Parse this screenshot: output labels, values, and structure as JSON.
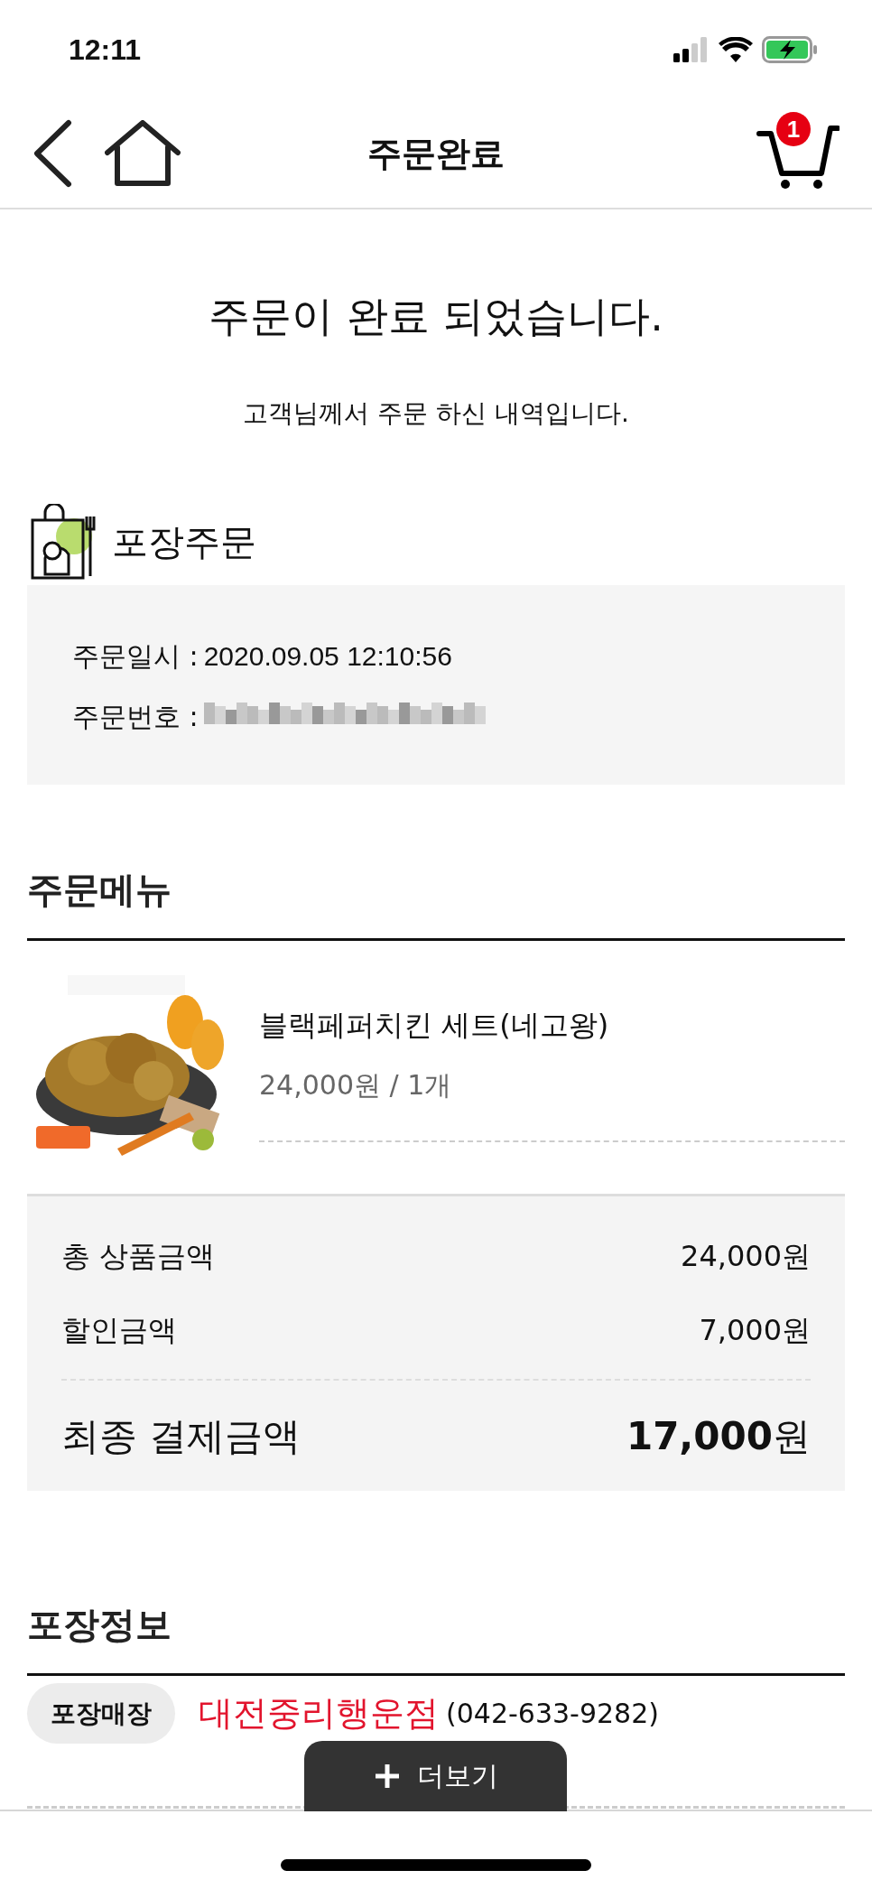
{
  "status_bar": {
    "time": "12:11"
  },
  "nav": {
    "title": "주문완료",
    "cart_count": "1"
  },
  "header": {
    "title": "주문이 완료 되었습니다.",
    "subtitle": "고객님께서 주문 하신 내역입니다."
  },
  "order_type": {
    "title": "포장주문"
  },
  "order_info": [
    {
      "label": "주문일시 :",
      "value": "2020.09.05 12:10:56",
      "kind": "text"
    },
    {
      "label": "주문번호 :",
      "kind": "blurred"
    }
  ],
  "menu_section": {
    "title": "주문메뉴",
    "items": [
      {
        "name": "블랙페퍼치킨 세트(네고왕)",
        "price": "24,000원 / 1개"
      }
    ]
  },
  "totals": [
    {
      "label": "총 상품금액",
      "amount": "24,000원",
      "kind": "line"
    },
    {
      "label": "할인금액",
      "amount": "7,000원",
      "kind": "line"
    },
    {
      "label": "최종 결제금액",
      "amount": "**17,000**원",
      "kind": "final"
    }
  ],
  "pickup": {
    "title": "포장정보",
    "tag": "포장매장",
    "store": "대전중리행운점",
    "phone": "(042-633-9282)"
  },
  "more_button": {
    "label": "더보기"
  }
}
